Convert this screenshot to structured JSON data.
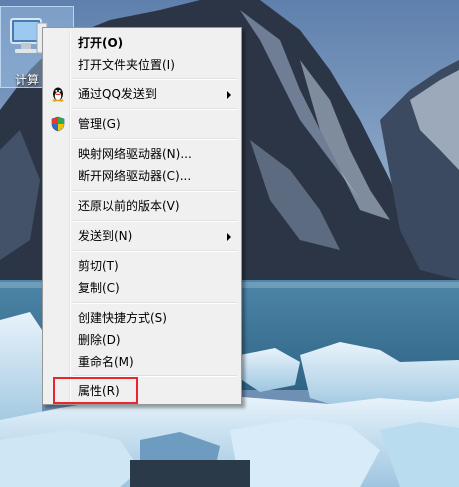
{
  "desktop": {
    "icon_label": "计算"
  },
  "menu": {
    "open": "打开(O)",
    "open_location": "打开文件夹位置(I)",
    "send_via_qq": "通过QQ发送到",
    "manage": "管理(G)",
    "map_drive": "映射网络驱动器(N)...",
    "disconnect_drive": "断开网络驱动器(C)...",
    "restore_versions": "还原以前的版本(V)",
    "send_to": "发送到(N)",
    "cut": "剪切(T)",
    "copy": "复制(C)",
    "create_shortcut": "创建快捷方式(S)",
    "delete": "删除(D)",
    "rename": "重命名(M)",
    "properties": "属性(R)"
  },
  "colors": {
    "highlight_border": "#e8262b",
    "menu_background": "#f0f0f0"
  }
}
